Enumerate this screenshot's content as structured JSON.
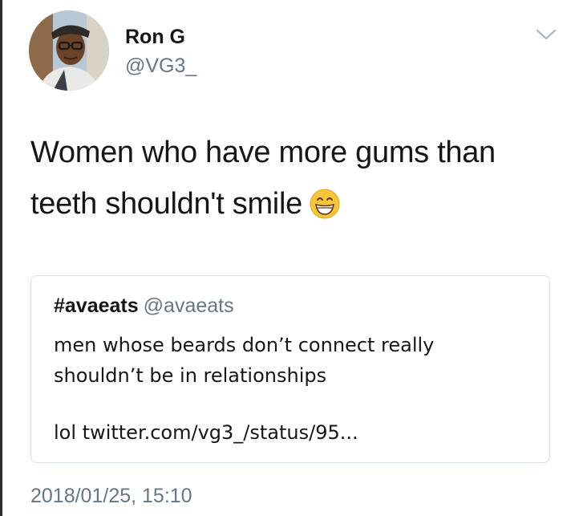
{
  "author": {
    "display_name": "Ron G",
    "handle": "@VG3_",
    "avatar": "avatar-photo"
  },
  "menu": {
    "icon": "chevron-down-icon"
  },
  "tweet": {
    "text_lines": [
      "Women who have more gums than",
      "teeth shouldn't smile"
    ],
    "emoji": "grinning-face-with-smiling-eyes-emoji"
  },
  "quoted_tweet": {
    "display_name": "#avaeats",
    "handle": "@avaeats",
    "text_lines": [
      "men whose beards don’t connect really",
      "shouldn’t be in relationships"
    ],
    "link_text": "lol twitter.com/vg3_/status/95..."
  },
  "timestamp": "2018/01/25, 15:10",
  "colors": {
    "text": "#14171a",
    "secondary_text": "#657786",
    "border": "#d7dee4",
    "emoji_yellow": "#f7c53a"
  }
}
